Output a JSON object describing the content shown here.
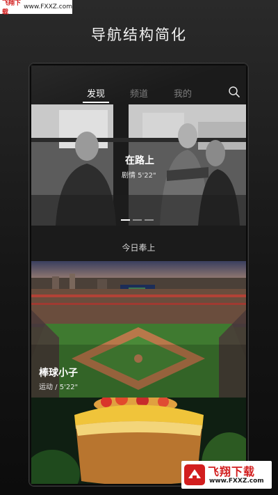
{
  "watermark_top": {
    "brand": "飞翔下载",
    "url": "www.FXXZ.com"
  },
  "headline": "导航结构简化",
  "nav": {
    "tabs": [
      {
        "label": "发现",
        "active": true
      },
      {
        "label": "频道",
        "active": false
      },
      {
        "label": "我的",
        "active": false
      }
    ],
    "search_icon": "search-icon"
  },
  "hero": {
    "title": "在路上",
    "meta": "剧情  5'22\"",
    "slides_total": 3,
    "slide_active": 1
  },
  "section_label": "今日奉上",
  "cards": [
    {
      "title": "棒球小子",
      "meta": "运动 / 5'22\""
    }
  ],
  "watermark_bottom": {
    "brand": "飞翔下载",
    "url": "www.FXXZ.com"
  },
  "colors": {
    "accent_red": "#d21e1e",
    "tab_inactive": "#7d7d7d",
    "background": "#161616"
  }
}
